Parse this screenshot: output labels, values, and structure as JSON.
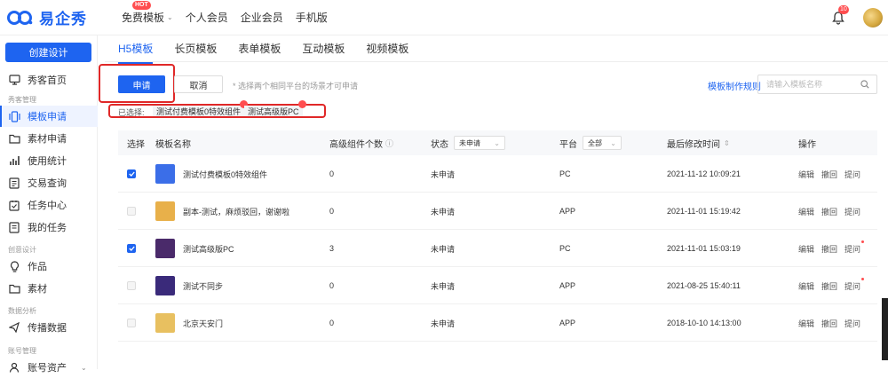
{
  "header": {
    "logo_text": "易企秀",
    "nav": [
      {
        "label": "免费模板",
        "badge": "HOT",
        "has_dropdown": true
      },
      {
        "label": "个人会员"
      },
      {
        "label": "企业会员"
      },
      {
        "label": "手机版"
      }
    ],
    "notification_count": "10"
  },
  "sidebar": {
    "create_button": "创建设计",
    "items": [
      {
        "label": "秀客首页",
        "icon": "monitor-icon"
      },
      {
        "group": "秀客管理"
      },
      {
        "label": "模板申请",
        "icon": "template-icon",
        "active": true
      },
      {
        "label": "素材申请",
        "icon": "folder-icon"
      },
      {
        "label": "使用统计",
        "icon": "bar-chart-icon"
      },
      {
        "label": "交易查询",
        "icon": "document-icon"
      },
      {
        "label": "任务中心",
        "icon": "task-icon"
      },
      {
        "label": "我的任务",
        "icon": "list-icon"
      },
      {
        "group": "创意设计"
      },
      {
        "label": "作品",
        "icon": "bulb-icon"
      },
      {
        "label": "素材",
        "icon": "folder-icon"
      },
      {
        "group": "数据分析"
      },
      {
        "label": "传播数据",
        "icon": "send-icon"
      },
      {
        "group": "账号管理"
      },
      {
        "label": "账号资产",
        "icon": "user-icon"
      }
    ]
  },
  "tabs": [
    "H5模板",
    "长页模板",
    "表单模板",
    "互动模板",
    "视频模板"
  ],
  "actions": {
    "apply": "申请",
    "cancel": "取消",
    "hint": "* 选择两个相同平台的场景才可申请",
    "rules_link": "模板制作规则",
    "search_placeholder": "请输入模板名称"
  },
  "selection": {
    "label": "已选择:",
    "chips": [
      "测试付费模板0特效组件",
      "测试高级版PC"
    ]
  },
  "table": {
    "headers": {
      "select": "选择",
      "name": "模板名称",
      "components": "高级组件个数",
      "status": "状态",
      "status_filter": "未申请",
      "platform": "平台",
      "platform_filter": "全部",
      "modified": "最后修改时间",
      "ops": "操作"
    },
    "rows": [
      {
        "checked": true,
        "name": "测试付费模板0特效组件",
        "components": "0",
        "status": "未申请",
        "platform": "PC",
        "modified": "2021-11-12 10:09:21",
        "thumb": "#3b6ee8",
        "ops": [
          "编辑",
          "撤回",
          "提问"
        ]
      },
      {
        "checked": false,
        "name": "副本-测试，麻烦驳回，谢谢啦",
        "components": "0",
        "status": "未申请",
        "platform": "APP",
        "modified": "2021-11-01 15:19:42",
        "thumb": "#e8b04a",
        "ops": [
          "编辑",
          "撤回",
          "提问"
        ]
      },
      {
        "checked": true,
        "name": "测试高级版PC",
        "components": "3",
        "status": "未申请",
        "platform": "PC",
        "modified": "2021-11-01 15:03:19",
        "thumb": "#4a2a6a",
        "ops": [
          "编辑",
          "撤回",
          "提问"
        ]
      },
      {
        "checked": false,
        "name": "测试不同步",
        "components": "0",
        "status": "未申请",
        "platform": "APP",
        "modified": "2021-08-25 15:40:11",
        "thumb": "#3a2a7a",
        "ops": [
          "编辑",
          "撤回",
          "提问"
        ]
      },
      {
        "checked": false,
        "name": "北京天安门",
        "components": "0",
        "status": "未申请",
        "platform": "APP",
        "modified": "2018-10-10 14:13:00",
        "thumb": "#e8c060",
        "ops": [
          "编辑",
          "撤回",
          "提问"
        ]
      }
    ]
  }
}
